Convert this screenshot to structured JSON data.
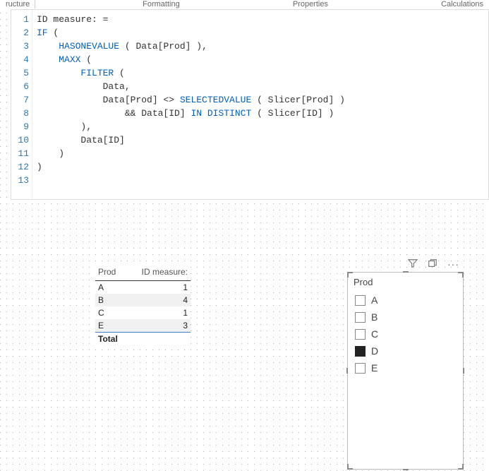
{
  "ribbon": {
    "left": "ructure",
    "tabs": [
      "Formatting",
      "Properties",
      "Calculations"
    ]
  },
  "editor": {
    "lines": [
      "ID measure: =",
      "IF (",
      "    HASONEVALUE ( Data[Prod] ),",
      "    MAXX (",
      "        FILTER (",
      "            Data,",
      "            Data[Prod] <> SELECTEDVALUE ( Slicer[Prod] )",
      "                && Data[ID] IN DISTINCT ( Slicer[ID] )",
      "        ),",
      "        Data[ID]",
      "    )",
      ")",
      ""
    ]
  },
  "table": {
    "headers": [
      "Prod",
      "ID measure:"
    ],
    "rows": [
      {
        "prod": "A",
        "val": "1"
      },
      {
        "prod": "B",
        "val": "4"
      },
      {
        "prod": "C",
        "val": "1"
      },
      {
        "prod": "E",
        "val": "3"
      }
    ],
    "total_label": "Total"
  },
  "slicer": {
    "title": "Prod",
    "items": [
      {
        "label": "A",
        "checked": false
      },
      {
        "label": "B",
        "checked": false
      },
      {
        "label": "C",
        "checked": false
      },
      {
        "label": "D",
        "checked": true
      },
      {
        "label": "E",
        "checked": false
      }
    ]
  },
  "visual_header": {
    "filter_icon": "⧩",
    "focus_icon": "⧉",
    "more_icon": "···"
  }
}
